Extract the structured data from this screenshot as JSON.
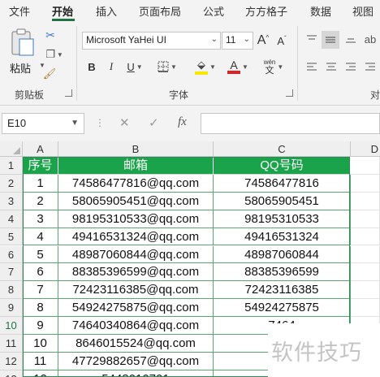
{
  "menu": {
    "tabs": [
      "文件",
      "开始",
      "插入",
      "页面布局",
      "公式",
      "方方格子",
      "数据",
      "视图"
    ],
    "active_tab": "开始"
  },
  "ribbon": {
    "clipboard": {
      "paste_label": "粘贴",
      "group_label": "剪贴板"
    },
    "font": {
      "font_name": "Microsoft YaHei UI",
      "font_size": "11",
      "increase_font": "A",
      "decrease_font": "A",
      "bold": "B",
      "italic": "I",
      "underline": "U",
      "font_color_letter": "A",
      "phonetic_top": "wén",
      "phonetic_bottom": "文",
      "group_label": "字体",
      "fill_color": "#f7e600",
      "font_color": "#e02020"
    },
    "alignment": {
      "group_label": "对"
    }
  },
  "formula_bar": {
    "name_box": "E10",
    "cancel_symbol": "✕",
    "enter_symbol": "✓",
    "fx_label": "fx",
    "formula_value": ""
  },
  "sheet": {
    "column_headers": [
      "A",
      "B",
      "C",
      "D"
    ],
    "row_numbers": [
      "1",
      "2",
      "3",
      "4",
      "5",
      "6",
      "7",
      "8",
      "9",
      "10",
      "11",
      "12",
      "13"
    ],
    "selected_row": "10",
    "header_row": [
      "序号",
      "邮箱",
      "QQ号码"
    ],
    "rows": [
      [
        "1",
        "74586477816@qq.com",
        "74586477816"
      ],
      [
        "2",
        "58065905451@qq.com",
        "58065905451"
      ],
      [
        "3",
        "98195310533@qq.com",
        "98195310533"
      ],
      [
        "4",
        "49416531324@qq.com",
        "49416531324"
      ],
      [
        "5",
        "48987060844@qq.com",
        "48987060844"
      ],
      [
        "6",
        "88385396599@qq.com",
        "88385396599"
      ],
      [
        "7",
        "72423116385@qq.com",
        "72423116385"
      ],
      [
        "8",
        "54924275875@qq.com",
        "54924275875"
      ],
      [
        "9",
        "74640340864@qq.com",
        "7464"
      ],
      [
        "10",
        "8646015524@qq.com",
        "864"
      ],
      [
        "11",
        "47729882657@qq.com",
        "4772"
      ],
      [
        "12",
        "5448010701",
        "544"
      ]
    ],
    "header_color": "#1aa34a"
  },
  "watermark": "软件技巧"
}
